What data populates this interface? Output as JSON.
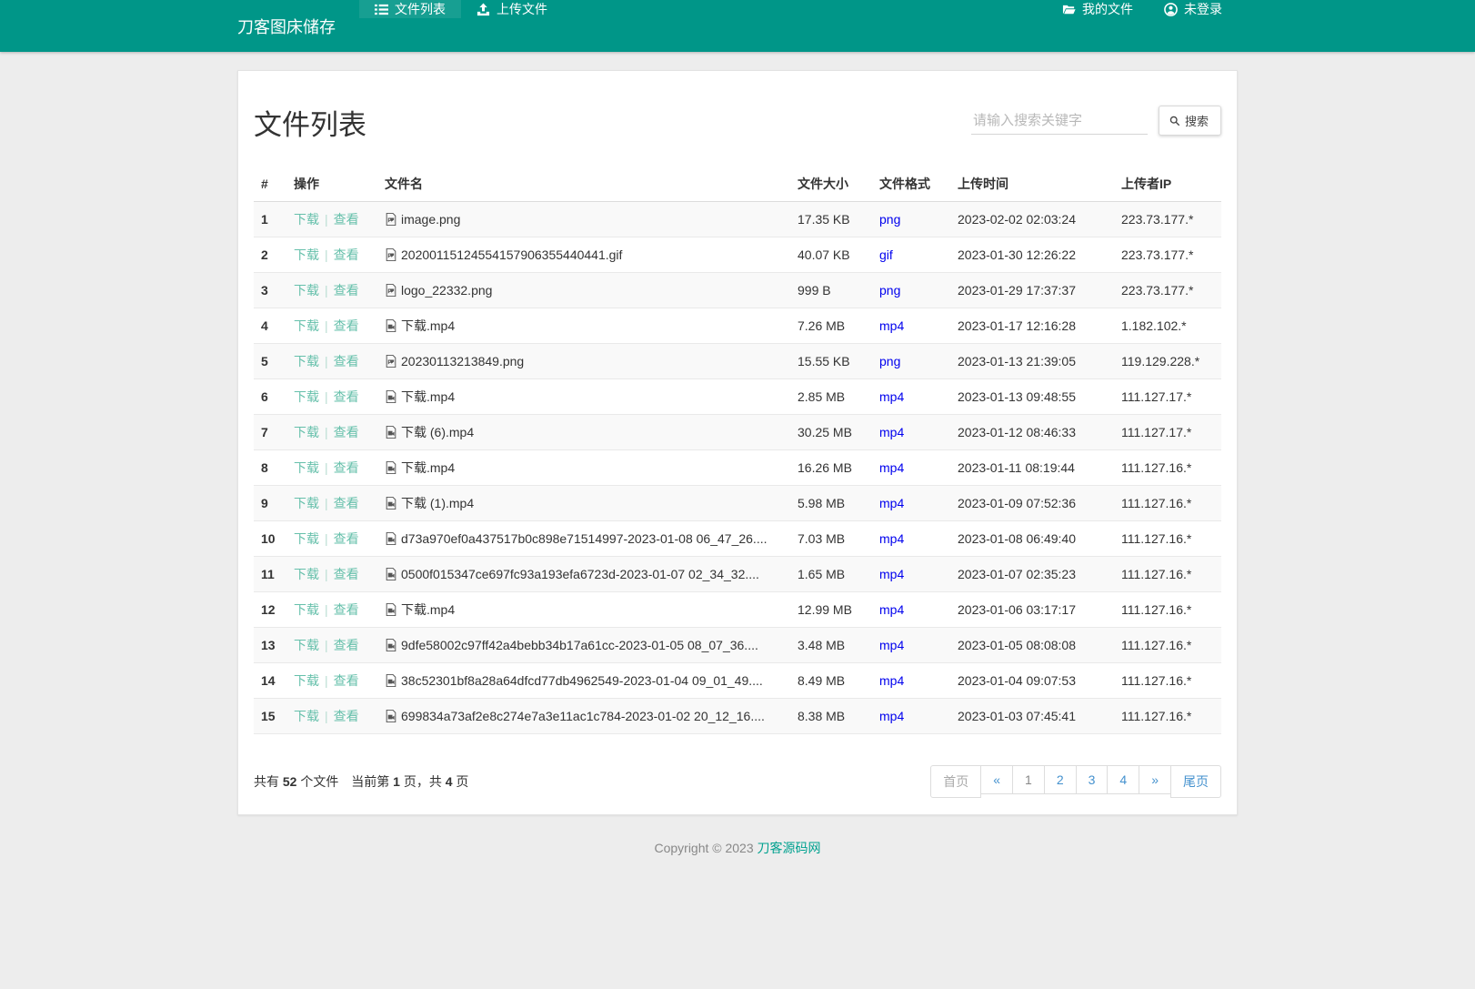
{
  "navbar": {
    "brand": "刀客图床储存",
    "items": [
      {
        "label": "文件列表",
        "icon": "list-icon",
        "active": true
      },
      {
        "label": "上传文件",
        "icon": "upload-icon",
        "active": false
      }
    ],
    "right_items": [
      {
        "label": "我的文件",
        "icon": "folder-open-icon"
      },
      {
        "label": "未登录",
        "icon": "user-circle-icon"
      }
    ]
  },
  "page": {
    "title": "文件列表",
    "search_placeholder": "请输入搜索关键字",
    "search_button": "搜索"
  },
  "table": {
    "columns": [
      "#",
      "操作",
      "文件名",
      "文件大小",
      "文件格式",
      "上传时间",
      "上传者IP"
    ],
    "actions": {
      "download": "下载",
      "view": "查看",
      "separator": "|"
    },
    "rows": [
      {
        "index": "1",
        "filename": "image.png",
        "file_icon": "image-file-icon",
        "size": "17.35 KB",
        "format": "png",
        "time": "2023-02-02 02:03:24",
        "ip": "223.73.177.*"
      },
      {
        "index": "2",
        "filename": "20200115124554157906355440441.gif",
        "file_icon": "image-file-icon",
        "size": "40.07 KB",
        "format": "gif",
        "time": "2023-01-30 12:26:22",
        "ip": "223.73.177.*"
      },
      {
        "index": "3",
        "filename": "logo_22332.png",
        "file_icon": "image-file-icon",
        "size": "999 B",
        "format": "png",
        "time": "2023-01-29 17:37:37",
        "ip": "223.73.177.*"
      },
      {
        "index": "4",
        "filename": "下载.mp4",
        "file_icon": "video-file-icon",
        "size": "7.26 MB",
        "format": "mp4",
        "time": "2023-01-17 12:16:28",
        "ip": "1.182.102.*"
      },
      {
        "index": "5",
        "filename": "20230113213849.png",
        "file_icon": "image-file-icon",
        "size": "15.55 KB",
        "format": "png",
        "time": "2023-01-13 21:39:05",
        "ip": "119.129.228.*"
      },
      {
        "index": "6",
        "filename": "下载.mp4",
        "file_icon": "video-file-icon",
        "size": "2.85 MB",
        "format": "mp4",
        "time": "2023-01-13 09:48:55",
        "ip": "111.127.17.*"
      },
      {
        "index": "7",
        "filename": "下载 (6).mp4",
        "file_icon": "video-file-icon",
        "size": "30.25 MB",
        "format": "mp4",
        "time": "2023-01-12 08:46:33",
        "ip": "111.127.17.*"
      },
      {
        "index": "8",
        "filename": "下载.mp4",
        "file_icon": "video-file-icon",
        "size": "16.26 MB",
        "format": "mp4",
        "time": "2023-01-11 08:19:44",
        "ip": "111.127.16.*"
      },
      {
        "index": "9",
        "filename": "下载 (1).mp4",
        "file_icon": "video-file-icon",
        "size": "5.98 MB",
        "format": "mp4",
        "time": "2023-01-09 07:52:36",
        "ip": "111.127.16.*"
      },
      {
        "index": "10",
        "filename": "d73a970ef0a437517b0c898e71514997-2023-01-08 06_47_26....",
        "file_icon": "video-file-icon",
        "size": "7.03 MB",
        "format": "mp4",
        "time": "2023-01-08 06:49:40",
        "ip": "111.127.16.*"
      },
      {
        "index": "11",
        "filename": "0500f015347ce697fc93a193efa6723d-2023-01-07 02_34_32....",
        "file_icon": "video-file-icon",
        "size": "1.65 MB",
        "format": "mp4",
        "time": "2023-01-07 02:35:23",
        "ip": "111.127.16.*"
      },
      {
        "index": "12",
        "filename": "下载.mp4",
        "file_icon": "video-file-icon",
        "size": "12.99 MB",
        "format": "mp4",
        "time": "2023-01-06 03:17:17",
        "ip": "111.127.16.*"
      },
      {
        "index": "13",
        "filename": "9dfe58002c97ff42a4bebb34b17a61cc-2023-01-05 08_07_36....",
        "file_icon": "video-file-icon",
        "size": "3.48 MB",
        "format": "mp4",
        "time": "2023-01-05 08:08:08",
        "ip": "111.127.16.*"
      },
      {
        "index": "14",
        "filename": "38c52301bf8a28a64dfcd77db4962549-2023-01-04 09_01_49....",
        "file_icon": "video-file-icon",
        "size": "8.49 MB",
        "format": "mp4",
        "time": "2023-01-04 09:07:53",
        "ip": "111.127.16.*"
      },
      {
        "index": "15",
        "filename": "699834a73af2e8c274e7a3e11ac1c784-2023-01-02 20_12_16....",
        "file_icon": "video-file-icon",
        "size": "8.38 MB",
        "format": "mp4",
        "time": "2023-01-03 07:45:41",
        "ip": "111.127.16.*"
      }
    ]
  },
  "footer_bar": {
    "summary": {
      "part1": "共有",
      "file_count": "52",
      "part2": "个文件",
      "part3": "当前第",
      "current_page": "1",
      "part4": "页，共",
      "total_pages": "4",
      "part5": "页"
    },
    "pagination": [
      {
        "label": "首页",
        "state": "disabled"
      },
      {
        "label": "«",
        "state": "normal"
      },
      {
        "label": "1",
        "state": "current"
      },
      {
        "label": "2",
        "state": "normal"
      },
      {
        "label": "3",
        "state": "normal"
      },
      {
        "label": "4",
        "state": "normal"
      },
      {
        "label": "»",
        "state": "normal"
      },
      {
        "label": "尾页",
        "state": "normal"
      }
    ]
  },
  "footer": {
    "copyright": "Copyright © 2023 ",
    "link": "刀客源码网"
  },
  "colors": {
    "navbar_bg": "#009688",
    "action_link": "#66c0ab",
    "format_link": "#0000ee",
    "pagination_link": "#4491ce"
  }
}
